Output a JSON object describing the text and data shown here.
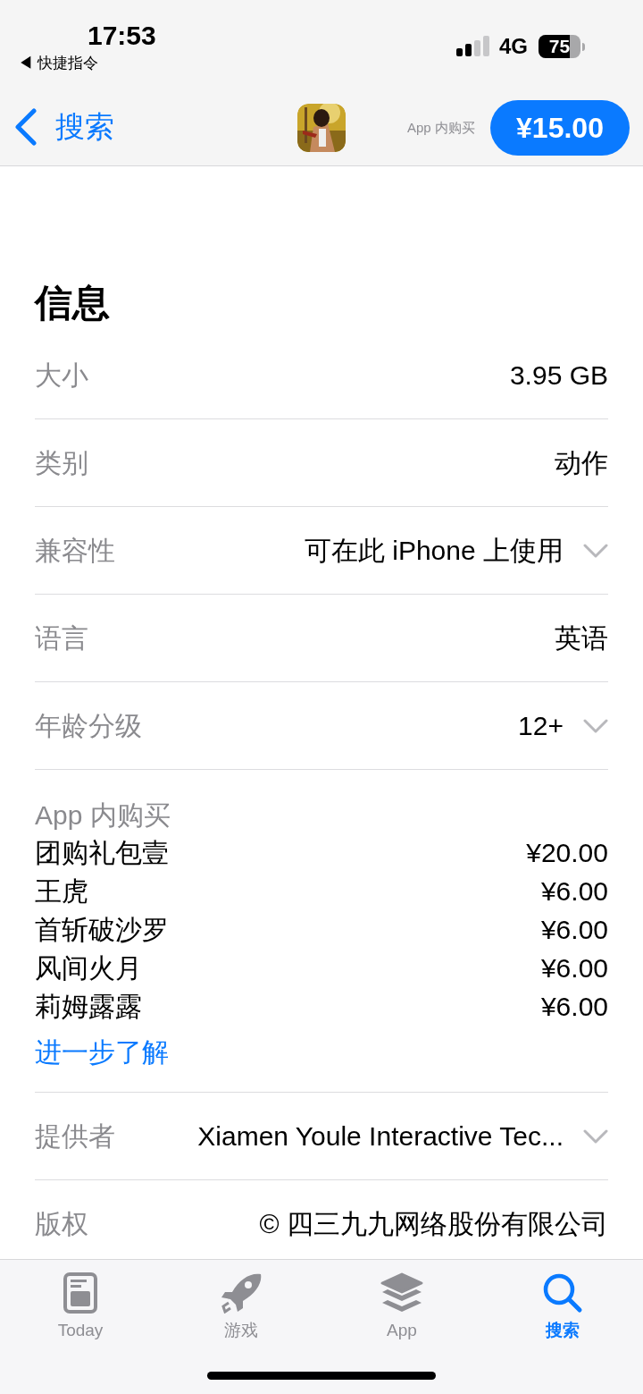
{
  "status_bar": {
    "time": "17:53",
    "back_app": "◀ 快捷指令",
    "network": "4G",
    "battery": "75"
  },
  "nav": {
    "back": "搜索",
    "in_app_note": "App 内购买",
    "price": "¥15.00"
  },
  "section_title": "信息",
  "rows": [
    {
      "label": "大小",
      "value": "3.95 GB",
      "expandable": false
    },
    {
      "label": "类别",
      "value": "动作",
      "expandable": false
    },
    {
      "label": "兼容性",
      "value": "可在此 iPhone 上使用",
      "expandable": true
    },
    {
      "label": "语言",
      "value": "英语",
      "expandable": false
    },
    {
      "label": "年龄分级",
      "value": "12+",
      "expandable": true
    }
  ],
  "in_app_purchases": {
    "label": "App 内购买",
    "items": [
      {
        "name": "团购礼包壹",
        "price": "¥20.00"
      },
      {
        "name": "王虎",
        "price": "¥6.00"
      },
      {
        "name": "首斩破沙罗",
        "price": "¥6.00"
      },
      {
        "name": "风间火月",
        "price": "¥6.00"
      },
      {
        "name": "莉姆露露",
        "price": "¥6.00"
      }
    ],
    "link": "进一步了解"
  },
  "rows_after": [
    {
      "label": "提供者",
      "value": "Xiamen Youle Interactive Tec...",
      "expandable": true
    },
    {
      "label": "版权",
      "value": "© 四三九九网络股份有限公司",
      "expandable": false
    }
  ],
  "tabs": [
    {
      "kind": "today",
      "label": "Today",
      "selected": false
    },
    {
      "kind": "games",
      "label": "游戏",
      "selected": false
    },
    {
      "kind": "apps",
      "label": "App",
      "selected": false
    },
    {
      "kind": "search",
      "label": "搜索",
      "selected": true
    }
  ]
}
